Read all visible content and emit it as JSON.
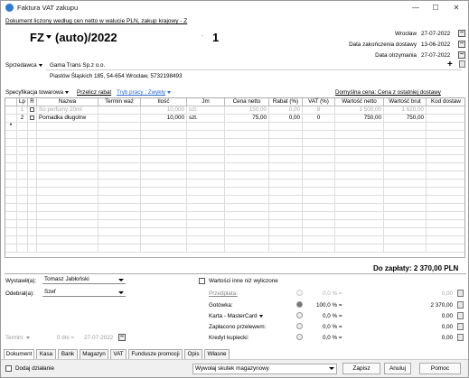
{
  "window": {
    "title": "Faktura VAT zakupu",
    "minimize": "—",
    "maximize": "☐",
    "close": "✕"
  },
  "doc_description": "Dokument liczony według cen netto w walucie PLN, zakup krajowy - Z",
  "header": {
    "series": "FZ",
    "auto_number": "(auto)/2022",
    "dash": "-",
    "number": "1"
  },
  "dates": [
    {
      "label": "Wrocław",
      "value": "27-07-2022"
    },
    {
      "label": "Data zakończenia dostawy",
      "value": "13-06-2022"
    },
    {
      "label": "Data otrzymania",
      "value": "27-07-2022"
    }
  ],
  "seller": {
    "label": "Sprzedawca",
    "name": "Gama Trans Sp.z o.o.",
    "address": "Piastów Śląskich 185, 54-654 Wrocław, 5732198493",
    "plus": "+"
  },
  "spec": {
    "label": "Specyfikacja towarowa",
    "recalc": "Przelicz rabat",
    "mode": "Tryb pracy : Zwykły",
    "default_price": "Domyślna cena: Cena z ostatniej dostawy"
  },
  "table": {
    "columns": [
      "Lp",
      "R",
      "Nazwa",
      "Termin waż",
      "Ilość",
      "Jm",
      "Cena netto",
      "Rabat (%)",
      "VAT (%)",
      "Wartość netto",
      "Wartość brut",
      "Kod dostaw"
    ],
    "rows": [
      {
        "lp": "1",
        "r": "",
        "name": "So perfumy 20ml",
        "term": "",
        "qty": "10,000",
        "unit": "szt.",
        "price": "150,00",
        "discount": "0,00",
        "vat": "8",
        "net": "1 500,00",
        "gross": "1 620,00",
        "code": "",
        "grayed": true
      },
      {
        "lp": "2",
        "r": "",
        "name": "Pomadka długotrw",
        "term": "",
        "qty": "10,000",
        "unit": "szt.",
        "price": "75,00",
        "discount": "0,00",
        "vat": "0",
        "net": "750,00",
        "gross": "750,00",
        "code": "",
        "grayed": false
      }
    ],
    "new_row_marker": "*"
  },
  "total": "Do zapłaty: 2 370,00 PLN",
  "issued_by": {
    "label": "Wystawił(a):",
    "value": "Tomasz Jabłoński"
  },
  "received_by": {
    "label": "Odebrał(a):",
    "value": "Szef"
  },
  "other_values": "Wartości inne niż wyliczone",
  "payments": [
    {
      "label": "Przedpłata:",
      "percent": "0,0 % =",
      "amount": "0,00",
      "radio": "none",
      "disabled": true
    },
    {
      "label": "Gotówka:",
      "percent": "100,0 % =",
      "amount": "2 370,00",
      "radio": "on",
      "disabled": false
    },
    {
      "label": "Karta - MasterCard",
      "percent": "0,0 % =",
      "amount": "0,00",
      "radio": "off",
      "disabled": false
    },
    {
      "label": "Zapłacono przelewem:",
      "percent": "0,0 % =",
      "amount": "0,00",
      "radio": "off",
      "disabled": false
    },
    {
      "label": "Kredyt kupiecki:",
      "percent": "0,0 % =",
      "amount": "0,00",
      "radio": "off",
      "disabled": false
    }
  ],
  "term": {
    "label": "Termin:",
    "days": "0 dni =",
    "date": "27-07-2022"
  },
  "tabs": [
    "Dokument",
    "Kasa",
    "Bank",
    "Magazyn",
    "VAT",
    "Fundusze promocji",
    "Opis",
    "Własne"
  ],
  "footer": {
    "add_action": "Dodaj działanie",
    "effect": "Wywołaj skutek magazynowy",
    "save": "Zapisz",
    "cancel": "Anuluj",
    "help": "Pomoc"
  }
}
